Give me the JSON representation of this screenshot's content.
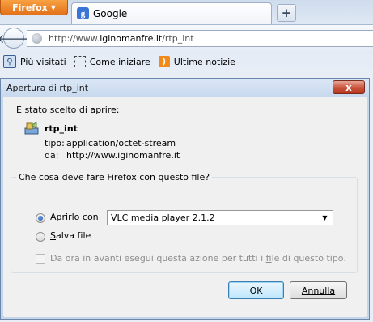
{
  "browser": {
    "app_menu_label": "Firefox",
    "tab_title": "Google",
    "tab_icon_letter": "g",
    "new_tab_label": "+",
    "url_prefix": "http://www.",
    "url_domain": "iginomanfre.it",
    "url_path": "/rtp_int",
    "bookmarks": [
      {
        "label": "Più visitati",
        "icon": "magnifier-icon"
      },
      {
        "label": "Come iniziare",
        "icon": "blank-page-icon"
      },
      {
        "label": "Ultime notizie",
        "icon": "rss-feed-icon"
      }
    ]
  },
  "dialog": {
    "title": "Apertura di rtp_int",
    "close_label": "x",
    "intro": "È stato scelto di aprire:",
    "file_name": "rtp_int",
    "type_label": "tipo:",
    "type_value": "application/octet-stream",
    "from_label": "da:",
    "from_value": "http://www.iginomanfre.it",
    "question": "Che cosa deve fare Firefox con questo file?",
    "open_with": {
      "label_u": "A",
      "label_rest": "prirlo con",
      "checked": true,
      "app": "VLC media player 2.1.2"
    },
    "save_file": {
      "label_u": "S",
      "label_rest": "alva file",
      "checked": false
    },
    "remember": {
      "label_pre": "Da ora in avanti esegui questa azione per tutti i ",
      "label_u": "f",
      "label_post": "ile di questo tipo.",
      "checked": false,
      "disabled": true
    },
    "ok_label": "OK",
    "cancel_label": "Annulla"
  }
}
